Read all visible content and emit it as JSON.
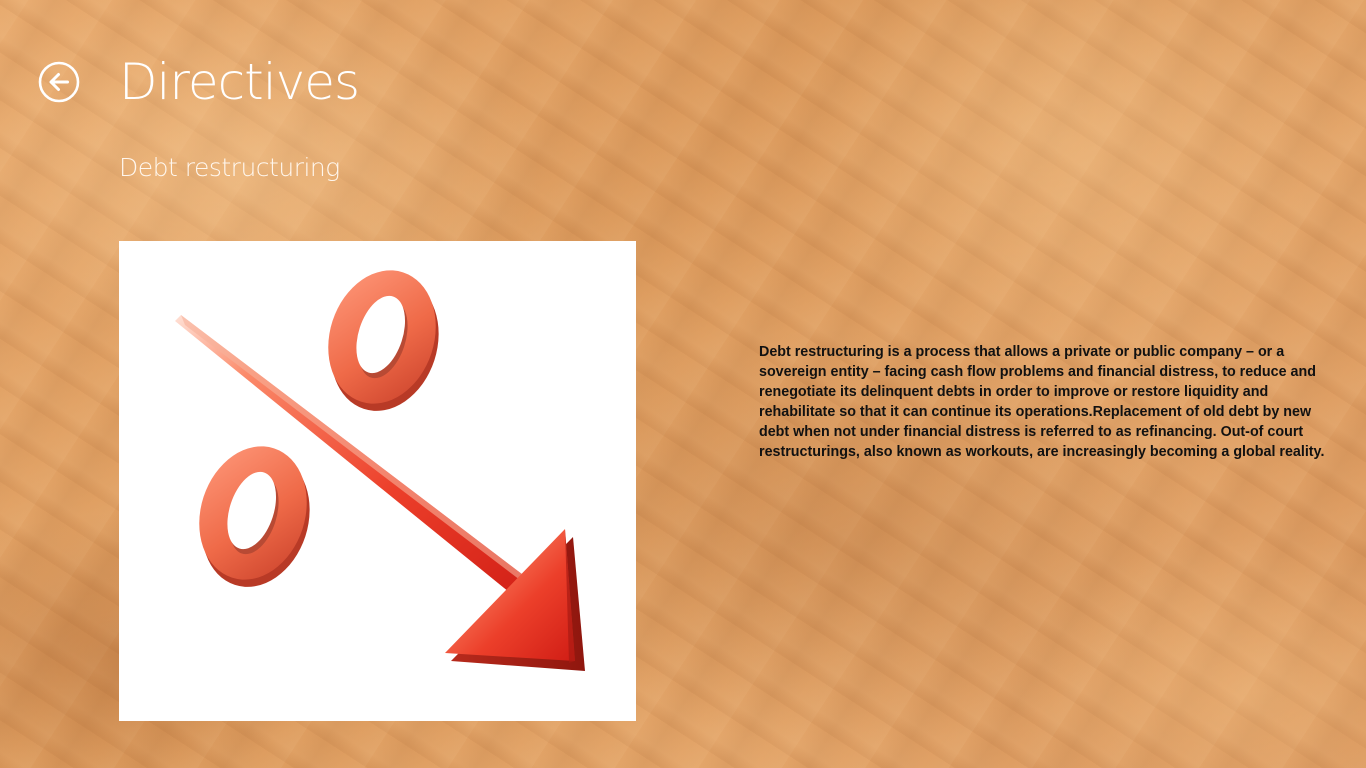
{
  "header": {
    "back_icon": "back-arrow-circle-icon",
    "title": "Directives"
  },
  "article": {
    "subtitle": "Debt restructuring",
    "image": {
      "icon": "percent-down-arrow-icon",
      "colors": {
        "glyph": "#ef6a48",
        "arrow": "#e5281f"
      }
    },
    "body": "Debt restructuring is a process that allows a private or public company – or a sovereign entity – facing cash flow problems and financial distress, to reduce and renegotiate its delinquent debts in order to improve or restore liquidity and rehabilitate so that it can continue its operations.Replacement of old debt by new debt when not under financial distress is referred to as refinancing. Out-of court restructurings, also known as workouts, are increasingly becoming a global reality."
  },
  "theme": {
    "background": "#e3a267",
    "title_color": "#ffffff",
    "body_color": "#111111"
  }
}
